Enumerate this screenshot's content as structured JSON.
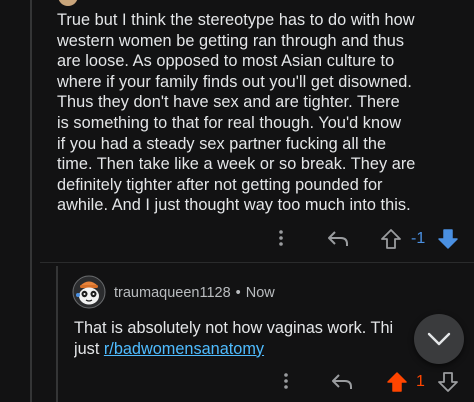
{
  "parent_comment": {
    "lines": [
      "True but I think the stereotype has to do with how",
      "western women be getting ran through and thus",
      "are loose. As opposed to most Asian culture to",
      "where if your family finds out you'll get disowned.",
      "Thus they don't have sex and are tighter. There",
      "is something to that for real though. You'd know",
      "if you had a steady sex partner fucking all the",
      "time. Then take like a week or so break. They are",
      "definitely tighter after not getting pounded for",
      "awhile. And I just thought way too much into this."
    ],
    "score": "-1",
    "vote_state": "downvoted",
    "score_color": "#4a90e2"
  },
  "reply_comment": {
    "username": "traumaqueen1128",
    "separator": "•",
    "timestamp": "Now",
    "text_before_link": "That is absolutely not how vaginas work. Thi",
    "text_line2_prefix": "just ",
    "link_text": "r/badwomensanatomy",
    "score": "1",
    "vote_state": "upvoted",
    "score_color": "#ff4500"
  },
  "colors": {
    "background": "#121213",
    "text": "#e4e6e8",
    "meta": "#b9bcbf",
    "link": "#4fbcff",
    "upvote": "#ff4500",
    "downvote": "#4a90e2",
    "icon": "#9a9c9f"
  },
  "icons": {
    "more": "more-vertical-icon",
    "reply": "reply-arrow-icon",
    "upvote": "upvote-arrow-icon",
    "downvote": "downvote-arrow-icon",
    "scroll_down": "chevron-down-icon",
    "avatar": "snoo-avatar-icon"
  }
}
